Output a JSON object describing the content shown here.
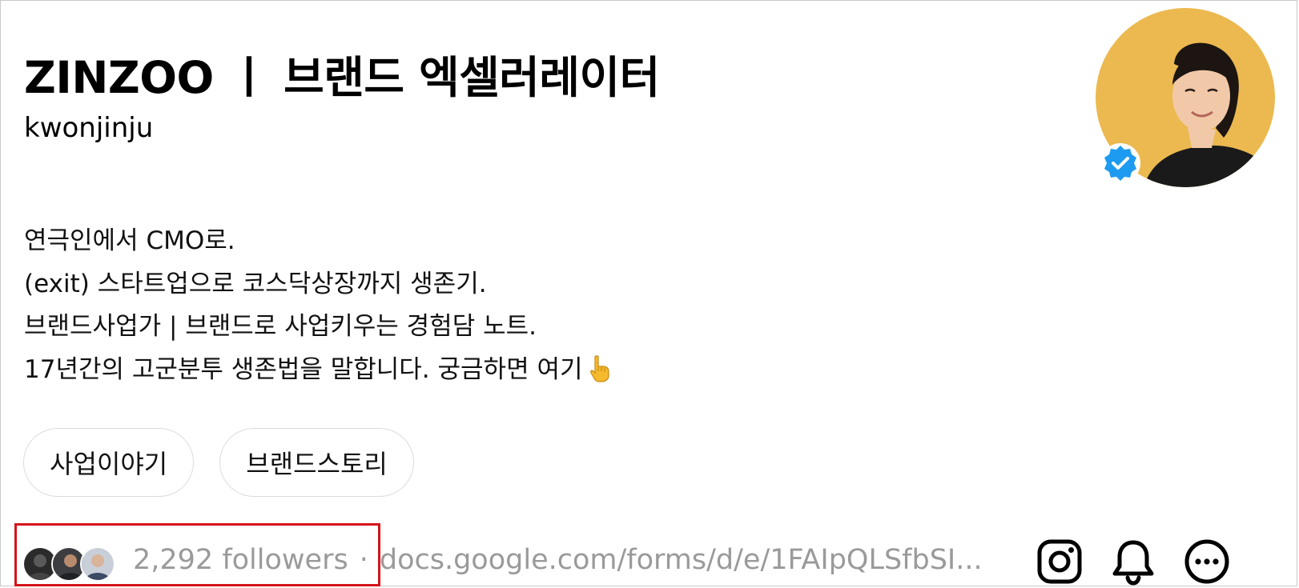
{
  "profile": {
    "title": "ZINZOO ㅣ 브랜드 엑셀러레이터",
    "username": "kwonjinju",
    "verified": true,
    "bio_lines": [
      "연극인에서 CMO로.",
      "(exit) 스타트업으로 코스닥상장까지 생존기.",
      "브랜드사업가 | 브랜드로 사업키우는 경험담 노트.",
      "17년간의 고군분투 생존법을 말합니다. 궁금하면 여기"
    ],
    "bio_emoji_icon": "pointing-down-hand-icon"
  },
  "tags": [
    {
      "label": "사업이야기"
    },
    {
      "label": "브랜드스토리"
    }
  ],
  "footer": {
    "followers_text": "2,292 followers",
    "separator": "·",
    "link_text": "docs.google.com/forms/d/e/1FAIpQLSfbSI..."
  },
  "icons": {
    "instagram": "instagram-icon",
    "notifications": "bell-icon",
    "more": "more-options-icon"
  },
  "colors": {
    "verified_blue": "#1d9bf0",
    "highlight_red": "#d6141a",
    "muted_text": "#9a9a9a",
    "avatar_background": "#e8b449"
  }
}
